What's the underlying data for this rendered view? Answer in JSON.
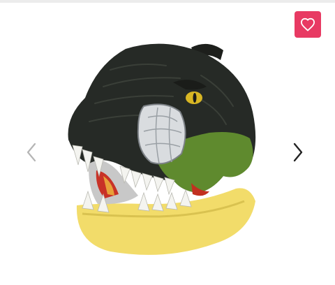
{
  "gallery": {
    "current_image": "t-rex-dinosaur-mask",
    "favorite_icon": "heart-icon",
    "prev_icon": "chevron-left-icon",
    "next_icon": "chevron-right-icon"
  },
  "colors": {
    "favorite_bg": "#e83a63",
    "favorite_icon": "#ffffff",
    "prev_arrow": "#b5b5b5",
    "next_arrow": "#222222",
    "mask_head": "#262a26",
    "mask_jaw": "#f2dc6a",
    "mask_accent_green": "#5f8a2e",
    "mask_teeth": "#f4f4f0"
  }
}
